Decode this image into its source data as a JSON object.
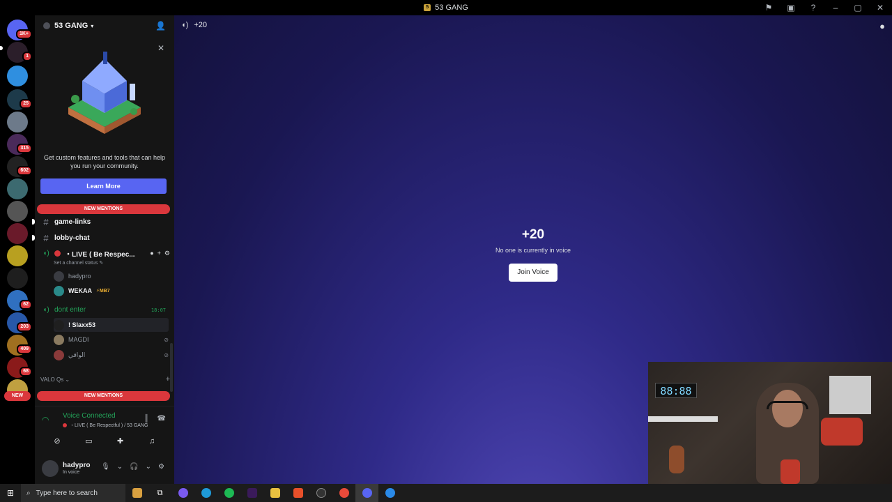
{
  "window": {
    "title": "53 GANG"
  },
  "server": {
    "name": "53 GANG"
  },
  "rail": {
    "top_badge": "1K+",
    "badges": [
      "1",
      "25",
      "315",
      "602",
      "62",
      "203",
      "409",
      "68"
    ],
    "new_label": "NEW"
  },
  "promo": {
    "text": "Get custom features and tools that can help you run your community.",
    "button": "Learn More"
  },
  "new_mentions_label": "NEW MENTIONS",
  "channels": [
    {
      "name": "game-links"
    },
    {
      "name": "lobby-chat"
    }
  ],
  "voice_channel_live": {
    "name": "・LIVE ( Be Respec...",
    "status_placeholder": "Set a channel status",
    "users": [
      {
        "name": "hadypro",
        "active": false
      },
      {
        "name": "WEKAA",
        "tag": "⚡MB7",
        "active": true
      }
    ]
  },
  "voice_channel_dont": {
    "name": "dont enter",
    "time": "18:07",
    "users": [
      {
        "name": "! Slaxx53",
        "active": true
      },
      {
        "name": "MAGDI",
        "active": false
      },
      {
        "name": "الواقي",
        "active": false
      }
    ]
  },
  "category": {
    "name": "VALO Qs"
  },
  "voice_connected": {
    "title": "Voice Connected",
    "subtitle": "・LIVE ( Be Respectful ) / 53 GANG"
  },
  "user": {
    "name": "hadypro",
    "status": "In voice"
  },
  "main": {
    "header_channel": "+20",
    "center_name": "+20",
    "center_message": "No one is currently in voice",
    "join_button": "Join Voice"
  },
  "webcam": {
    "clock": "88:88"
  },
  "taskbar": {
    "search_placeholder": "Type here to search"
  },
  "colors": {
    "accent": "#5865f2",
    "danger": "#da373c",
    "success": "#23a55a"
  }
}
